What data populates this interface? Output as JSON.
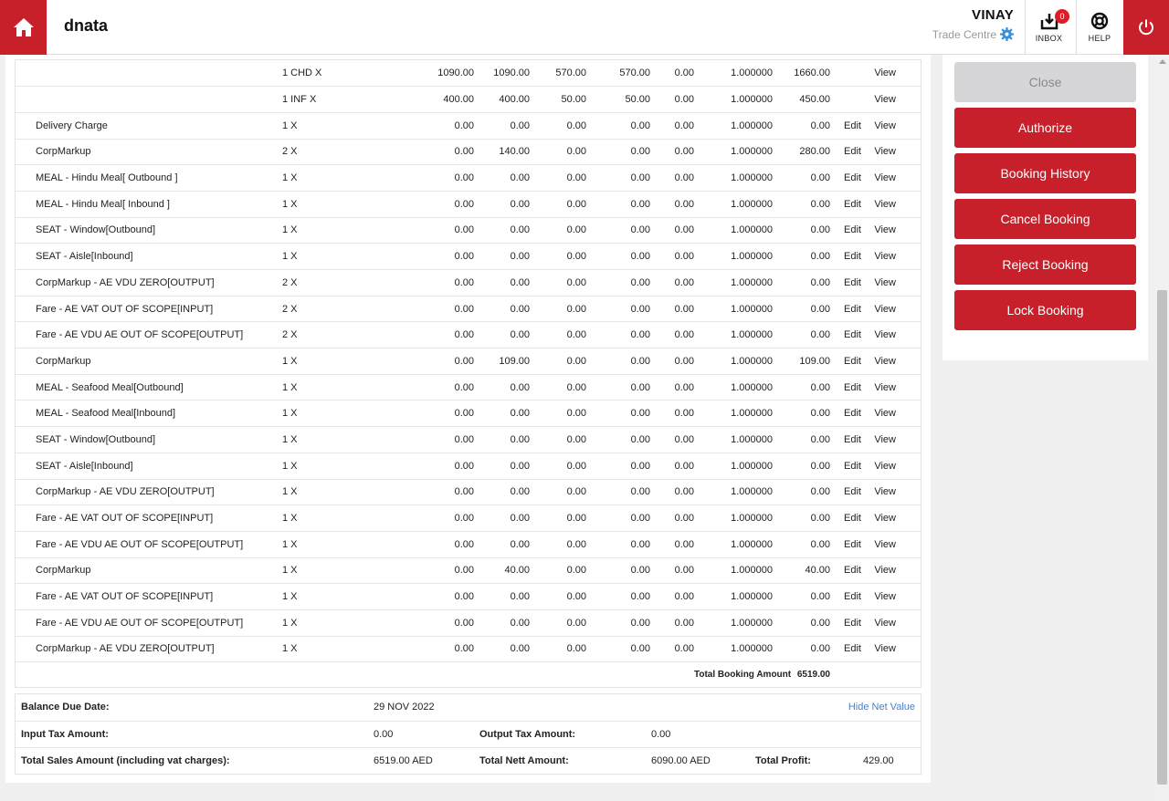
{
  "header": {
    "brand": "dnata",
    "user_name": "VINAY",
    "branch": "Trade Centre",
    "inbox_label": "INBOX",
    "inbox_count": "0",
    "help_label": "HELP"
  },
  "charges": [
    {
      "desc": "",
      "qty": "1 CHD X",
      "c1": "1090.00",
      "c2": "1090.00",
      "c3": "570.00",
      "c4": "570.00",
      "c5": "0.00",
      "c6": "1.000000",
      "c7": "1660.00",
      "edit": "",
      "view": "View"
    },
    {
      "desc": "",
      "qty": "1 INF X",
      "c1": "400.00",
      "c2": "400.00",
      "c3": "50.00",
      "c4": "50.00",
      "c5": "0.00",
      "c6": "1.000000",
      "c7": "450.00",
      "edit": "",
      "view": "View"
    },
    {
      "desc": "Delivery Charge",
      "qty": "1 X",
      "c1": "0.00",
      "c2": "0.00",
      "c3": "0.00",
      "c4": "0.00",
      "c5": "0.00",
      "c6": "1.000000",
      "c7": "0.00",
      "edit": "Edit",
      "view": "View"
    },
    {
      "desc": "CorpMarkup",
      "qty": "2 X",
      "c1": "0.00",
      "c2": "140.00",
      "c3": "0.00",
      "c4": "0.00",
      "c5": "0.00",
      "c6": "1.000000",
      "c7": "280.00",
      "edit": "Edit",
      "view": "View"
    },
    {
      "desc": "MEAL - Hindu Meal[ Outbound ]",
      "qty": "1 X",
      "c1": "0.00",
      "c2": "0.00",
      "c3": "0.00",
      "c4": "0.00",
      "c5": "0.00",
      "c6": "1.000000",
      "c7": "0.00",
      "edit": "Edit",
      "view": "View"
    },
    {
      "desc": "MEAL - Hindu Meal[ Inbound ]",
      "qty": "1 X",
      "c1": "0.00",
      "c2": "0.00",
      "c3": "0.00",
      "c4": "0.00",
      "c5": "0.00",
      "c6": "1.000000",
      "c7": "0.00",
      "edit": "Edit",
      "view": "View"
    },
    {
      "desc": "SEAT - Window[Outbound]",
      "qty": "1 X",
      "c1": "0.00",
      "c2": "0.00",
      "c3": "0.00",
      "c4": "0.00",
      "c5": "0.00",
      "c6": "1.000000",
      "c7": "0.00",
      "edit": "Edit",
      "view": "View"
    },
    {
      "desc": "SEAT - Aisle[Inbound]",
      "qty": "1 X",
      "c1": "0.00",
      "c2": "0.00",
      "c3": "0.00",
      "c4": "0.00",
      "c5": "0.00",
      "c6": "1.000000",
      "c7": "0.00",
      "edit": "Edit",
      "view": "View"
    },
    {
      "desc": "CorpMarkup - AE VDU ZERO[OUTPUT]",
      "qty": "2 X",
      "c1": "0.00",
      "c2": "0.00",
      "c3": "0.00",
      "c4": "0.00",
      "c5": "0.00",
      "c6": "1.000000",
      "c7": "0.00",
      "edit": "Edit",
      "view": "View"
    },
    {
      "desc": "Fare - AE VAT OUT OF SCOPE[INPUT]",
      "qty": "2 X",
      "c1": "0.00",
      "c2": "0.00",
      "c3": "0.00",
      "c4": "0.00",
      "c5": "0.00",
      "c6": "1.000000",
      "c7": "0.00",
      "edit": "Edit",
      "view": "View"
    },
    {
      "desc": "Fare - AE VDU AE OUT OF SCOPE[OUTPUT]",
      "qty": "2 X",
      "c1": "0.00",
      "c2": "0.00",
      "c3": "0.00",
      "c4": "0.00",
      "c5": "0.00",
      "c6": "1.000000",
      "c7": "0.00",
      "edit": "Edit",
      "view": "View"
    },
    {
      "desc": "CorpMarkup",
      "qty": "1 X",
      "c1": "0.00",
      "c2": "109.00",
      "c3": "0.00",
      "c4": "0.00",
      "c5": "0.00",
      "c6": "1.000000",
      "c7": "109.00",
      "edit": "Edit",
      "view": "View"
    },
    {
      "desc": "MEAL - Seafood Meal[Outbound]",
      "qty": "1 X",
      "c1": "0.00",
      "c2": "0.00",
      "c3": "0.00",
      "c4": "0.00",
      "c5": "0.00",
      "c6": "1.000000",
      "c7": "0.00",
      "edit": "Edit",
      "view": "View"
    },
    {
      "desc": "MEAL - Seafood Meal[Inbound]",
      "qty": "1 X",
      "c1": "0.00",
      "c2": "0.00",
      "c3": "0.00",
      "c4": "0.00",
      "c5": "0.00",
      "c6": "1.000000",
      "c7": "0.00",
      "edit": "Edit",
      "view": "View"
    },
    {
      "desc": "SEAT - Window[Outbound]",
      "qty": "1 X",
      "c1": "0.00",
      "c2": "0.00",
      "c3": "0.00",
      "c4": "0.00",
      "c5": "0.00",
      "c6": "1.000000",
      "c7": "0.00",
      "edit": "Edit",
      "view": "View"
    },
    {
      "desc": "SEAT - Aisle[Inbound]",
      "qty": "1 X",
      "c1": "0.00",
      "c2": "0.00",
      "c3": "0.00",
      "c4": "0.00",
      "c5": "0.00",
      "c6": "1.000000",
      "c7": "0.00",
      "edit": "Edit",
      "view": "View"
    },
    {
      "desc": "CorpMarkup - AE VDU ZERO[OUTPUT]",
      "qty": "1 X",
      "c1": "0.00",
      "c2": "0.00",
      "c3": "0.00",
      "c4": "0.00",
      "c5": "0.00",
      "c6": "1.000000",
      "c7": "0.00",
      "edit": "Edit",
      "view": "View"
    },
    {
      "desc": "Fare - AE VAT OUT OF SCOPE[INPUT]",
      "qty": "1 X",
      "c1": "0.00",
      "c2": "0.00",
      "c3": "0.00",
      "c4": "0.00",
      "c5": "0.00",
      "c6": "1.000000",
      "c7": "0.00",
      "edit": "Edit",
      "view": "View"
    },
    {
      "desc": "Fare - AE VDU AE OUT OF SCOPE[OUTPUT]",
      "qty": "1 X",
      "c1": "0.00",
      "c2": "0.00",
      "c3": "0.00",
      "c4": "0.00",
      "c5": "0.00",
      "c6": "1.000000",
      "c7": "0.00",
      "edit": "Edit",
      "view": "View"
    },
    {
      "desc": "CorpMarkup",
      "qty": "1 X",
      "c1": "0.00",
      "c2": "40.00",
      "c3": "0.00",
      "c4": "0.00",
      "c5": "0.00",
      "c6": "1.000000",
      "c7": "40.00",
      "edit": "Edit",
      "view": "View"
    },
    {
      "desc": "Fare - AE VAT OUT OF SCOPE[INPUT]",
      "qty": "1 X",
      "c1": "0.00",
      "c2": "0.00",
      "c3": "0.00",
      "c4": "0.00",
      "c5": "0.00",
      "c6": "1.000000",
      "c7": "0.00",
      "edit": "Edit",
      "view": "View"
    },
    {
      "desc": "Fare - AE VDU AE OUT OF SCOPE[OUTPUT]",
      "qty": "1 X",
      "c1": "0.00",
      "c2": "0.00",
      "c3": "0.00",
      "c4": "0.00",
      "c5": "0.00",
      "c6": "1.000000",
      "c7": "0.00",
      "edit": "Edit",
      "view": "View"
    },
    {
      "desc": "CorpMarkup - AE VDU ZERO[OUTPUT]",
      "qty": "1 X",
      "c1": "0.00",
      "c2": "0.00",
      "c3": "0.00",
      "c4": "0.00",
      "c5": "0.00",
      "c6": "1.000000",
      "c7": "0.00",
      "edit": "Edit",
      "view": "View"
    }
  ],
  "total": {
    "label": "Total Booking Amount",
    "value": "6519.00"
  },
  "summary": {
    "balance_due_label": "Balance Due Date:",
    "balance_due_value": "29 NOV 2022",
    "hide_net_value": "Hide Net Value",
    "input_tax_label": "Input Tax Amount:",
    "input_tax_value": "0.00",
    "output_tax_label": "Output Tax Amount:",
    "output_tax_value": "0.00",
    "total_sales_label": "Total Sales Amount (including vat charges):",
    "total_sales_value": "6519.00 AED",
    "total_nett_label": "Total Nett Amount:",
    "total_nett_value": "6090.00 AED",
    "total_profit_label": "Total Profit:",
    "total_profit_value": "429.00"
  },
  "actions": {
    "close": "Close",
    "authorize": "Authorize",
    "booking_history": "Booking History",
    "cancel_booking": "Cancel Booking",
    "reject_booking": "Reject Booking",
    "lock_booking": "Lock Booking"
  },
  "colors": {
    "brand_red": "#c8202a",
    "link_blue": "#4a7fc1",
    "disabled_grey": "#d6d6d8"
  }
}
